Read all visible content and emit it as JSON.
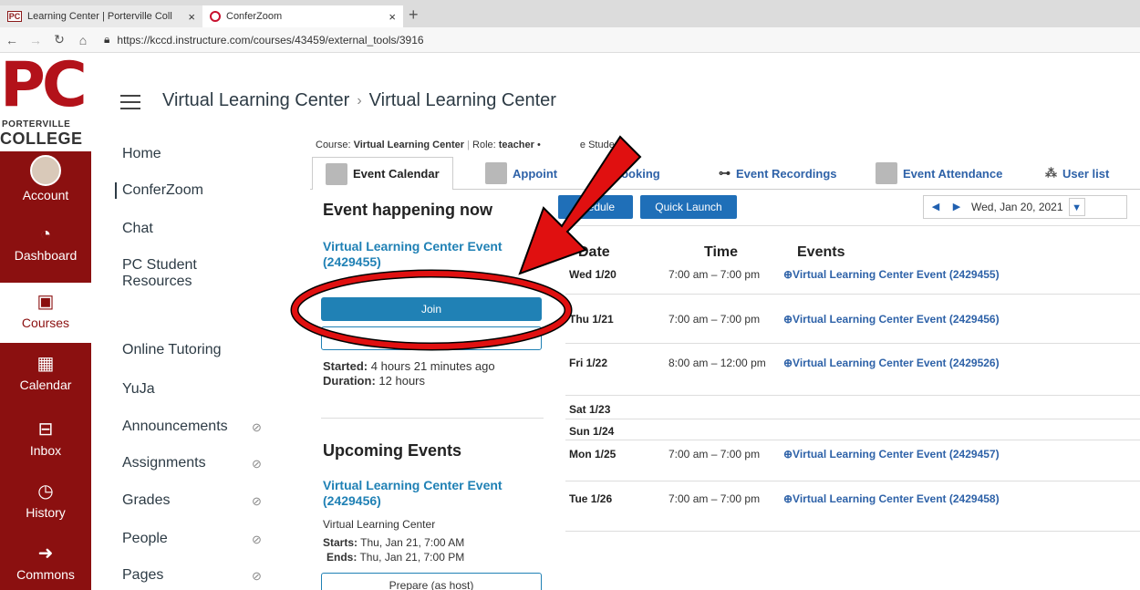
{
  "browser": {
    "tabs": [
      {
        "favicon": "PC",
        "label": "Learning Center | Porterville Coll"
      },
      {
        "favicon": "",
        "label": "ConferZoom"
      }
    ],
    "url": "https://kccd.instructure.com/courses/43459/external_tools/3916"
  },
  "logo": {
    "initials": "PC",
    "line1": "PORTERVILLE",
    "line2": "COLLEGE"
  },
  "global_nav": [
    {
      "label": "Account",
      "icon": "avatar-icon"
    },
    {
      "label": "Dashboard",
      "icon": "dashboard-icon",
      "glyph": "◔"
    },
    {
      "label": "Courses",
      "icon": "book-icon",
      "glyph": "▣"
    },
    {
      "label": "Calendar",
      "icon": "calendar-icon",
      "glyph": "▦"
    },
    {
      "label": "Inbox",
      "icon": "inbox-icon",
      "glyph": "⊟"
    },
    {
      "label": "History",
      "icon": "clock-icon",
      "glyph": "◷"
    },
    {
      "label": "Commons",
      "icon": "commons-icon",
      "glyph": "➜"
    }
  ],
  "breadcrumb": {
    "first": "Virtual Learning Center",
    "second": "Virtual Learning Center",
    "separator": "›"
  },
  "course_nav": [
    {
      "label": "Home",
      "hidden": false
    },
    {
      "label": "ConferZoom",
      "hidden": false
    },
    {
      "label": "Chat",
      "hidden": false
    },
    {
      "label": "PC Student",
      "hidden": false
    },
    {
      "label": "Resources",
      "hidden": false
    },
    {
      "label": "Online Tutoring",
      "hidden": false
    },
    {
      "label": "YuJa",
      "hidden": false
    },
    {
      "label": "Announcements",
      "hidden": true
    },
    {
      "label": "Assignments",
      "hidden": true
    },
    {
      "label": "Grades",
      "hidden": true
    },
    {
      "label": "People",
      "hidden": true
    },
    {
      "label": "Pages",
      "hidden": true
    }
  ],
  "role_line": {
    "course_label": "Course:",
    "course": "Virtual Learning Center",
    "role_label": "Role:",
    "role": "teacher",
    "tail": "e Student"
  },
  "tool_tabs": [
    "Event Calendar",
    "Appoint",
    "ooking",
    "Event Recordings",
    "Event Attendance",
    "User list"
  ],
  "now": {
    "heading": "Event happening now",
    "title": "Virtual Learning Center Event (2429455)",
    "join": "Join",
    "started_label": "Started:",
    "started": "4 hours 21 minutes ago",
    "duration_label": "Duration:",
    "duration": "12 hours"
  },
  "upcoming": {
    "heading": "Upcoming Events",
    "title": "Virtual Learning Center Event (2429456)",
    "course": "Virtual Learning Center",
    "starts_label": "Starts:",
    "starts": "Thu, Jan 21, 7:00 AM",
    "ends_label": "Ends:",
    "ends": "Thu, Jan 21, 7:00 PM",
    "prepare": "Prepare (as host)"
  },
  "controls": {
    "schedule": "chedule",
    "quick_launch": "Quick Launch",
    "date": "Wed, Jan 20, 2021"
  },
  "schedule_headers": {
    "date": "Date",
    "time": "Time",
    "events": "Events"
  },
  "schedule": [
    {
      "date": "Wed 1/20",
      "time": "7:00 am – 7:00 pm",
      "event": "⊕Virtual Learning Center Event (2429455)"
    },
    {
      "date": "Thu 1/21",
      "time": "7:00 am – 7:00 pm",
      "event": "⊕Virtual Learning Center Event (2429456)"
    },
    {
      "date": "Fri 1/22",
      "time": "8:00 am – 12:00 pm",
      "event": "⊕Virtual Learning Center Event (2429526)"
    },
    {
      "date": "Sat 1/23",
      "time": "",
      "event": ""
    },
    {
      "date": "Sun 1/24",
      "time": "",
      "event": ""
    },
    {
      "date": "Mon 1/25",
      "time": "7:00 am – 7:00 pm",
      "event": "⊕Virtual Learning Center Event (2429457)"
    },
    {
      "date": "Tue 1/26",
      "time": "7:00 am – 7:00 pm",
      "event": "⊕Virtual Learning Center Event (2429458)"
    }
  ],
  "colors": {
    "canvas_nav": "#8b1010",
    "link": "#2081b5",
    "annotation": "#e01010"
  }
}
